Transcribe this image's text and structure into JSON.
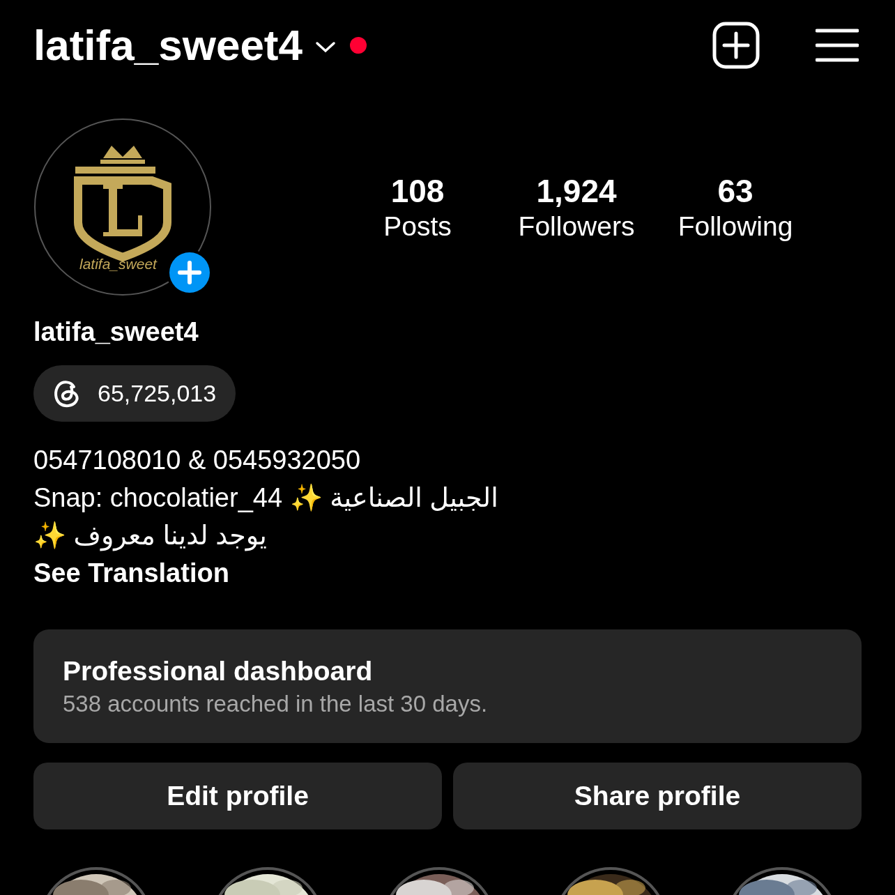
{
  "header": {
    "username": "latifa_sweet4",
    "has_notification": true
  },
  "profile": {
    "avatar_text": "latifa_sweet",
    "stats": [
      {
        "value": "108",
        "label": "Posts"
      },
      {
        "value": "1,924",
        "label": "Followers"
      },
      {
        "value": "63",
        "label": "Following"
      }
    ],
    "name": "latifa_sweet4",
    "threads_badge": "65,725,013",
    "bio": [
      "0547108010 & 0545932050",
      "Snap: chocolatier_44 ✨ الجبيل الصناعية",
      "يوجد لدينا معروف ✨"
    ],
    "see_translation": "See Translation"
  },
  "dashboard": {
    "title": "Professional dashboard",
    "subtitle": "538 accounts reached in the last 30 days."
  },
  "buttons": [
    "Edit profile",
    "Share profile"
  ],
  "highlights": [
    {
      "kind": "picture"
    },
    {
      "kind": "picture"
    },
    {
      "kind": "picture"
    },
    {
      "kind": "picture"
    },
    {
      "kind": "picture"
    }
  ]
}
